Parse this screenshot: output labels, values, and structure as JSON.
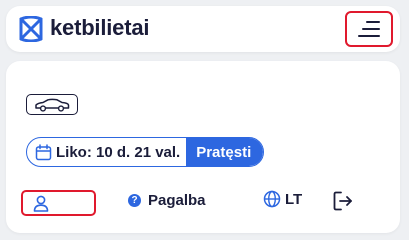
{
  "header": {
    "brand": "ketbilietai",
    "menu_icon": "hamburger-menu-icon"
  },
  "colors": {
    "accent_blue": "#2d67e0",
    "highlight_red": "#e0192d",
    "text_dark": "#1b1d3a",
    "background": "#eef0f3"
  },
  "vehicle": {
    "icon": "car-icon"
  },
  "parking": {
    "icon": "calendar-icon",
    "time_left": "Liko: 10 d. 21 val.",
    "extend_label": "Pratęsti"
  },
  "footer": {
    "user_icon": "user-icon",
    "help_icon": "question-circle-icon",
    "help_glyph": "?",
    "help_label": "Pagalba",
    "lang_icon": "globe-icon",
    "lang_label": "LT",
    "logout_icon": "logout-icon"
  }
}
